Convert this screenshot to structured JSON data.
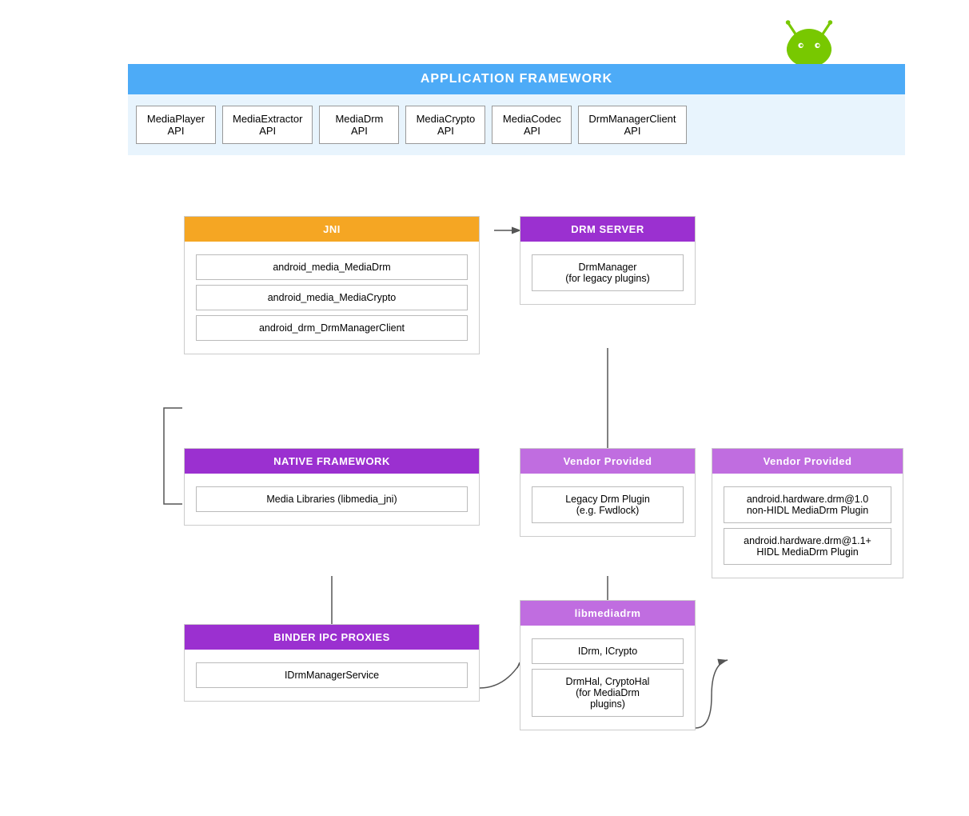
{
  "android_logo": {
    "alt": "Android Logo"
  },
  "app_framework": {
    "header": "APPLICATION FRAMEWORK",
    "apis": [
      {
        "line1": "MediaPlayer",
        "line2": "API"
      },
      {
        "line1": "MediaExtractor",
        "line2": "API"
      },
      {
        "line1": "MediaDrm",
        "line2": "API"
      },
      {
        "line1": "MediaCrypto",
        "line2": "API"
      },
      {
        "line1": "MediaCodec",
        "line2": "API"
      },
      {
        "line1": "DrmManagerClient",
        "line2": "API"
      }
    ]
  },
  "jni": {
    "header": "JNI",
    "items": [
      "android_media_MediaDrm",
      "android_media_MediaCrypto",
      "android_drm_DrmManagerClient"
    ]
  },
  "drm_server": {
    "header": "DRM SERVER",
    "items": [
      "DrmManager\n(for legacy plugins)"
    ]
  },
  "native_framework": {
    "header": "NATIVE FRAMEWORK",
    "items": [
      "Media Libraries (libmedia_jni)"
    ]
  },
  "vendor1": {
    "header": "Vendor Provided",
    "items": [
      "Legacy Drm Plugin\n(e.g. Fwdlock)"
    ]
  },
  "vendor2": {
    "header": "Vendor Provided",
    "items": [
      "android.hardware.drm@1.0\nnon-HIDL MediaDrm Plugin",
      "android.hardware.drm@1.1+\nHIDL MediaDrm Plugin"
    ]
  },
  "binder_ipc": {
    "header": "BINDER IPC PROXIES",
    "items": [
      "IDrmManagerService"
    ]
  },
  "libmediadrm": {
    "header": "libmediadrm",
    "items": [
      "IDrm, ICrypto",
      "DrmHal, CryptoHal\n(for MediaDrm\nplugins)"
    ]
  }
}
